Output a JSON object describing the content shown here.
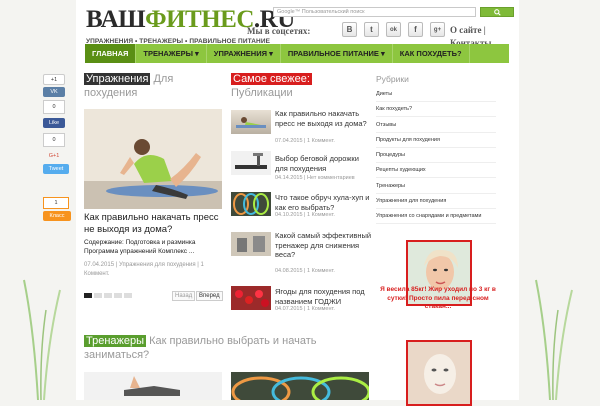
{
  "site": {
    "logo_part1": "ВАШ",
    "logo_part2": "ФИТНЕС",
    "logo_part3": ".RU",
    "tagline": "УПРАЖНЕНИЯ • ТРЕНАЖЕРЫ • ПРАВИЛЬНОЕ ПИТАНИЕ"
  },
  "search": {
    "placeholder": "Google™ Пользовательский поиск"
  },
  "social": {
    "label": "Мы в соцсетях:",
    "icons": [
      "B",
      "t",
      "ok",
      "f",
      "g+"
    ]
  },
  "top_links": {
    "about": "О сайте |",
    "contacts": "Контакты"
  },
  "nav": [
    {
      "label": "ГЛАВНАЯ"
    },
    {
      "label": "ТРЕНАЖЕРЫ ▾"
    },
    {
      "label": "УПРАЖНЕНИЯ ▾"
    },
    {
      "label": "ПРАВИЛЬНОЕ ПИТАНИЕ ▾"
    },
    {
      "label": "КАК ПОХУДЕТЬ?"
    }
  ],
  "section1": {
    "tag": "Упражнения",
    "rest": "Для похудения"
  },
  "featured": {
    "title": "Как правильно накачать пресс не выходя из дома?",
    "desc": "Содержание: Подготовка и разминка Программа упражнений Комплекс ...",
    "date": "07.04.2015",
    "category": "Упражнения для похудения",
    "comments": "1 Коммент.",
    "prev": "Назад",
    "next": "Вперед"
  },
  "section2": {
    "tag": "Самое свежее:",
    "rest": "Публикации"
  },
  "latest": [
    {
      "title": "Как правильно накачать пресс не выходя из дома?",
      "meta": "07.04.2015 | 1 Коммент."
    },
    {
      "title": "Выбор беговой дорожки для похудения",
      "meta": "04.14.2015 | Нет комментариев"
    },
    {
      "title": "Что такое обруч хула-хуп и как его выбрать?",
      "meta": "04.10.2015 | 1 Коммент."
    },
    {
      "title": "Какой самый эффективный тренажер для снижения веса?",
      "meta": "04.08.2015 | 1 Коммент."
    },
    {
      "title": "Ягоды для похудения под названием ГОДЖИ",
      "meta": "04.07.2015 | 1 Коммент."
    }
  ],
  "rubrics": {
    "title": "Рубрики",
    "items": [
      "Диеты",
      "Как похудеть?",
      "Отзывы",
      "Продукты для похудения",
      "Процедуры",
      "Рецепты худеющих",
      "Тренажеры",
      "Упражнения для похудения",
      "Упражнения со снарядами и предметами"
    ]
  },
  "ad": {
    "text": "Я весила 85кг! Жир уходил по 3 кг в сутки! Просто пила перед сном стакан..."
  },
  "section3": {
    "tag": "Тренажеры",
    "rest": "Как правильно выбрать и начать заниматься?"
  },
  "share": {
    "plus": "+1",
    "vk": "VK",
    "vk_count": "0",
    "fb_count": "0",
    "fb": "Like",
    "gplus_count": "0",
    "gplus": "G+1",
    "tw": "Tweet",
    "ok_count": "1",
    "ok": "Класс"
  }
}
